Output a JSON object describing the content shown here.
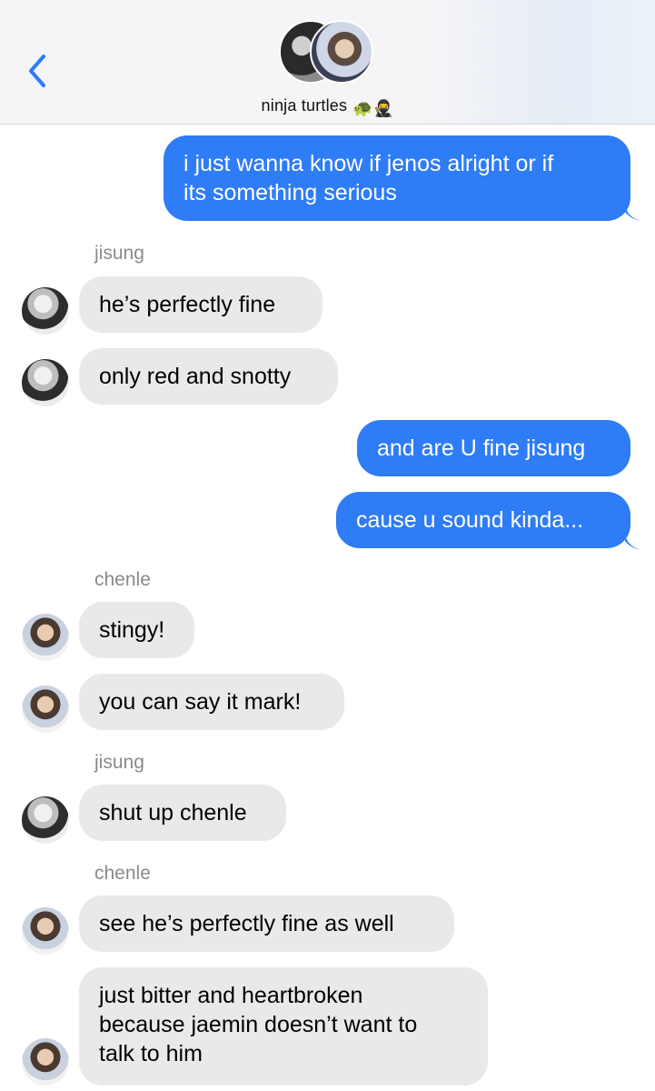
{
  "header": {
    "group_name": "ninja turtles",
    "emoji": "🐢🥷"
  },
  "messages": [
    {
      "id": "m1",
      "direction": "out",
      "text": "i just wanna know if jenos alright or if\nits something serious"
    },
    {
      "id": "m2",
      "direction": "in",
      "sender": "jisung",
      "text": "he’s perfectly fine"
    },
    {
      "id": "m3",
      "direction": "in",
      "sender": "jisung",
      "text": "only red and snotty"
    },
    {
      "id": "m4",
      "direction": "out",
      "text": "and are U fine jisung"
    },
    {
      "id": "m5",
      "direction": "out",
      "text": "cause u sound kinda..."
    },
    {
      "id": "m6",
      "direction": "in",
      "sender": "chenle",
      "text": "stingy!"
    },
    {
      "id": "m7",
      "direction": "in",
      "sender": "chenle",
      "text": "you can say it mark!"
    },
    {
      "id": "m8",
      "direction": "in",
      "sender": "jisung",
      "text": "shut up chenle"
    },
    {
      "id": "m9",
      "direction": "in",
      "sender": "chenle",
      "text": "see he’s perfectly fine as well"
    },
    {
      "id": "m10",
      "direction": "in",
      "sender": "chenle",
      "text": "just bitter and heartbroken\nbecause jaemin doesn’t want to\ntalk to him"
    }
  ],
  "sender_labels": {
    "jisung": "jisung",
    "chenle": "chenle"
  },
  "colors": {
    "outgoing_bubble": "#2e7cf6",
    "incoming_bubble": "#e9e9eb",
    "accent": "#2e7cf6"
  }
}
